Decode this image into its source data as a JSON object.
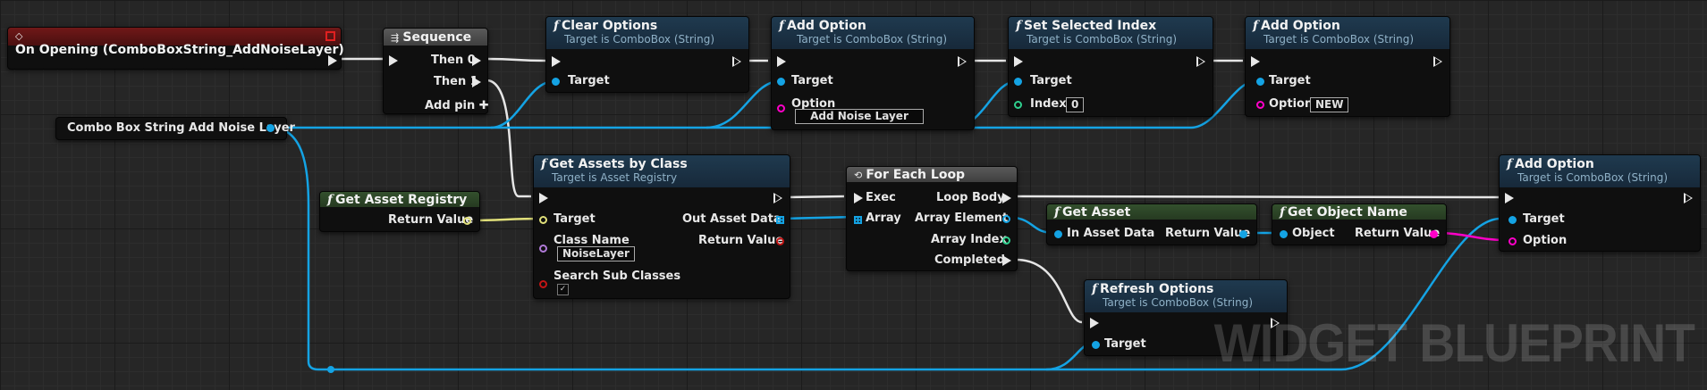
{
  "colors": {
    "exec": "#e8e8e8",
    "object_pin": "#14a3e4",
    "struct_pin": "#e1e07a",
    "class_pin": "#b07ad8",
    "string_pin": "#ff00c8",
    "int_pin": "#2fcf8e",
    "bool_pin": "#c21515",
    "function_header": "#1f3a4f",
    "pure_header": "#33502d",
    "event_header": "#701818"
  },
  "on_opening": {
    "title": "On Opening (ComboBoxString_AddNoiseLayer)",
    "icon": "event-diamond-icon"
  },
  "sequence": {
    "title": "Sequence",
    "then0": "Then 0",
    "then1": "Then 1",
    "add_pin": "Add pin",
    "icon": "sequence-icon"
  },
  "combo_var": {
    "label": "Combo Box String Add Noise Layer"
  },
  "clear_options": {
    "title": "Clear Options",
    "subtitle": "Target is ComboBox (String)",
    "target": "Target"
  },
  "add_option_1": {
    "title": "Add Option",
    "subtitle": "Target is ComboBox (String)",
    "target": "Target",
    "option": "Option",
    "option_value": "Add Noise Layer"
  },
  "set_selected_index": {
    "title": "Set Selected Index",
    "subtitle": "Target is ComboBox (String)",
    "target": "Target",
    "index": "Index",
    "index_value": "0"
  },
  "add_option_2": {
    "title": "Add Option",
    "subtitle": "Target is ComboBox (String)",
    "target": "Target",
    "option": "Option",
    "option_value": "NEW"
  },
  "get_asset_registry": {
    "title": "Get Asset Registry",
    "return_value": "Return Value"
  },
  "get_assets_by_class": {
    "title": "Get Assets by Class",
    "subtitle": "Target is Asset Registry",
    "target": "Target",
    "class_name": "Class Name",
    "class_name_value": "NoiseLayer",
    "search_sub_classes": "Search Sub Classes",
    "out_asset_data": "Out Asset Data",
    "return_value": "Return Value"
  },
  "for_each_loop": {
    "title": "For Each Loop",
    "exec": "Exec",
    "array": "Array",
    "loop_body": "Loop Body",
    "array_element": "Array Element",
    "array_index": "Array Index",
    "completed": "Completed",
    "icon": "loop-icon"
  },
  "get_asset": {
    "title": "Get Asset",
    "in_asset_data": "In Asset Data",
    "return_value": "Return Value"
  },
  "get_object_name": {
    "title": "Get Object Name",
    "object": "Object",
    "return_value": "Return Value"
  },
  "add_option_3": {
    "title": "Add Option",
    "subtitle": "Target is ComboBox (String)",
    "target": "Target",
    "option": "Option"
  },
  "refresh_options": {
    "title": "Refresh Options",
    "subtitle": "Target is ComboBox (String)",
    "target": "Target"
  },
  "watermark": "WIDGET BLUEPRINT"
}
